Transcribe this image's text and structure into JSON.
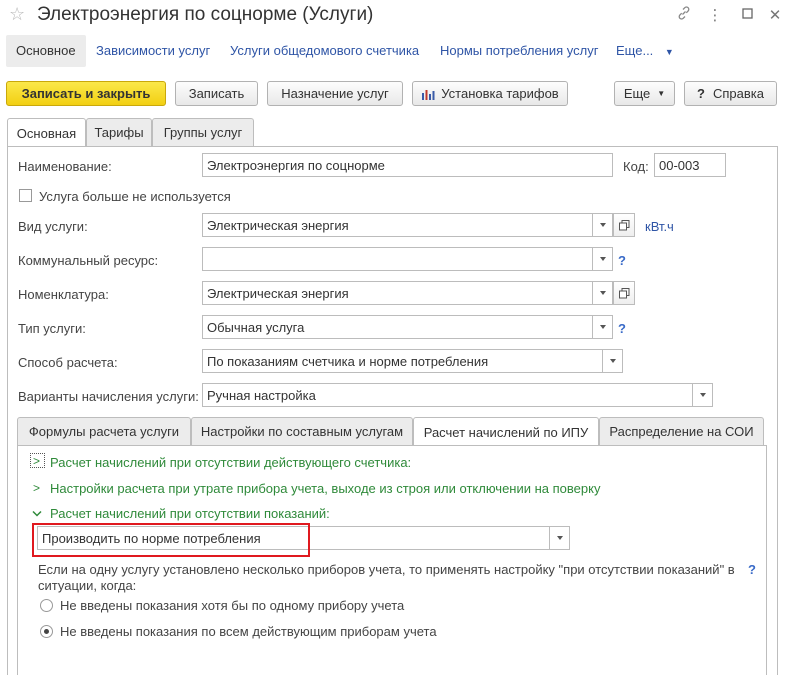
{
  "window": {
    "title": "Электроэнергия по соцнорме (Услуги)"
  },
  "nav": {
    "items": [
      "Основное",
      "Зависимости услуг",
      "Услуги общедомового счетчика",
      "Нормы потребления услуг",
      "Еще..."
    ]
  },
  "toolbar": {
    "save_close": "Записать и закрыть",
    "save": "Записать",
    "assign": "Назначение услуг",
    "tariffs": "Установка тарифов",
    "more": "Еще",
    "help": "Справка"
  },
  "tabs": [
    "Основная",
    "Тарифы",
    "Группы услуг"
  ],
  "form": {
    "name_label": "Наименование:",
    "name_value": "Электроэнергия по соцнорме",
    "code_label": "Код:",
    "code_value": "00-003",
    "unused_label": "Услуга больше не используется",
    "kind_label": "Вид услуги:",
    "kind_value": "Электрическая энергия",
    "kind_unit": "кВт.ч",
    "resource_label": "Коммунальный ресурс:",
    "resource_value": "",
    "nomenclature_label": "Номенклатура:",
    "nomenclature_value": "Электрическая энергия",
    "type_label": "Тип услуги:",
    "type_value": "Обычная услуга",
    "method_label": "Способ расчета:",
    "method_value": "По показаниям счетчика и норме потребления",
    "variants_label": "Варианты начисления услуги:",
    "variants_value": "Ручная настройка",
    "help_mark": "?"
  },
  "subtabs": [
    "Формулы расчета услуги",
    "Настройки по составным услугам",
    "Расчет начислений по ИПУ",
    "Распределение на СОИ"
  ],
  "ipu": {
    "group1": "Расчет начислений при отсутствии действующего счетчика:",
    "group2": "Настройки расчета при утрате прибора учета, выходе из строя или отключении на поверку",
    "group3": "Расчет начислений при отсутствии показаний:",
    "select_value": "Производить по норме потребления",
    "note_line1": "Если на одну услугу установлено несколько приборов учета, то применять настройку \"при отсутствии показаний\" в",
    "note_line2": "ситуации, когда:",
    "radio1": "Не введены показания хотя бы по одному прибору учета",
    "radio2": "Не введены показания по всем действующим приборам учета",
    "selected_radio": 2
  },
  "colors": {
    "primary_button": "#f5d71f",
    "link": "#2f55a6",
    "group_green": "#2f8a3a",
    "highlight_red": "#e0191f"
  }
}
